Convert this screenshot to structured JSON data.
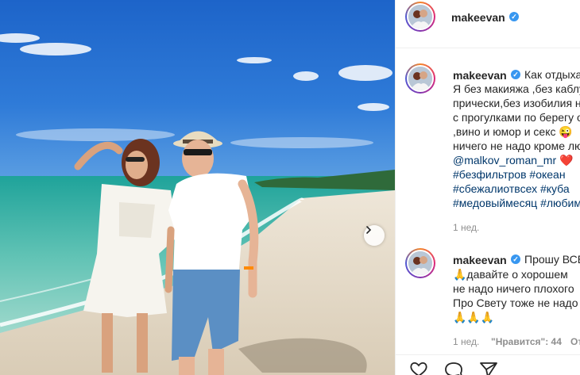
{
  "post": {
    "username": "makeevan",
    "verified_badge": "✓",
    "next_icon": "chevron-right-icon"
  },
  "caption": {
    "username": "makeevan",
    "lines": [
      "Как отдыхать",
      "Я без макияжа ,без каблуков",
      "прически,без изобилия нарядов",
      "с прогулками по берегу океана",
      ",вино и юмор и секс 😜",
      "ничего не надо кроме любви"
    ],
    "mention": "@malkov_roman_mr",
    "mention_suffix": " ❤️",
    "hashtag_lines": [
      "#безфильтров #океан",
      "#сбежалиотвсех #куба",
      "#медовыймесяц #любимый"
    ],
    "time": "1 нед."
  },
  "comment": {
    "username": "makeevan",
    "lines": [
      "Прошу ВСЕХ",
      "🙏давайте о хорошем",
      "не надо ничего плохого",
      "Про Свету тоже не надо",
      "🙏🙏🙏"
    ],
    "time": "1 нед.",
    "likes_label": "\"Нравится\": 44",
    "reply_label": "Ответить"
  },
  "actions": {
    "like_icon": "heart-icon",
    "comment_icon": "comment-icon",
    "share_icon": "share-icon"
  },
  "colors": {
    "link": "#00376b",
    "verified": "#3897f0",
    "muted": "#8e8e8e",
    "text": "#262626"
  }
}
